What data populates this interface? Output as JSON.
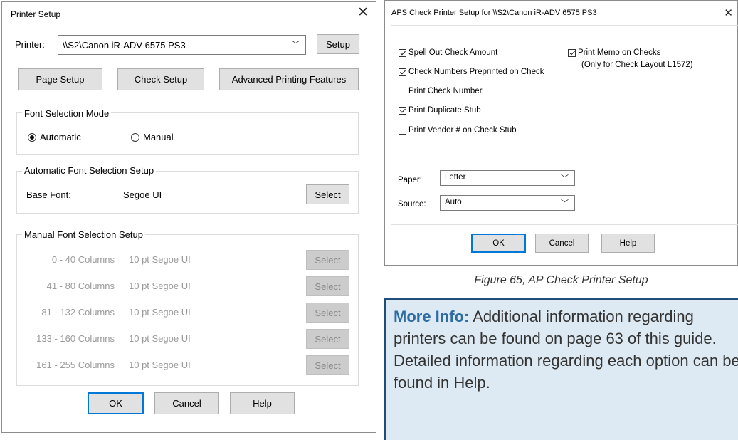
{
  "printer_setup": {
    "title": "Printer Setup",
    "printer_label": "Printer:",
    "printer_value": "\\\\S2\\Canon iR-ADV 6575 PS3",
    "setup_button": "Setup",
    "page_setup_button": "Page Setup",
    "check_setup_button": "Check Setup",
    "advanced_button": "Advanced Printing Features",
    "font_mode_group": "Font Selection Mode",
    "automatic_label": "Automatic",
    "manual_label": "Manual",
    "font_mode_selected": "Automatic",
    "auto_group": "Automatic Font Selection Setup",
    "base_font_label": "Base Font:",
    "base_font_value": "Segoe UI",
    "select_label": "Select",
    "manual_group": "Manual Font Selection Setup",
    "manual_rows": [
      {
        "columns": "0 - 40 Columns",
        "font": "10 pt Segoe UI",
        "button": "Select"
      },
      {
        "columns": "41 - 80 Columns",
        "font": "10 pt Segoe UI",
        "button": "Select"
      },
      {
        "columns": "81 - 132 Columns",
        "font": "10 pt Segoe UI",
        "button": "Select"
      },
      {
        "columns": "133 - 160 Columns",
        "font": "10 pt Segoe UI",
        "button": "Select"
      },
      {
        "columns": "161 - 255 Columns",
        "font": "10 pt Segoe UI",
        "button": "Select"
      }
    ],
    "ok": "OK",
    "cancel": "Cancel",
    "help": "Help"
  },
  "aps_setup": {
    "title": "APS Check Printer Setup for \\\\S2\\Canon iR-ADV 6575 PS3",
    "checkboxes": [
      {
        "label": "Spell Out Check Amount",
        "checked": true
      },
      {
        "label": "Check Numbers Preprinted on Check",
        "checked": true
      },
      {
        "label": "Print Check Number",
        "checked": false
      },
      {
        "label": "Print Duplicate Stub",
        "checked": true
      },
      {
        "label": "Print Vendor # on Check Stub",
        "checked": false
      }
    ],
    "memo_checkbox": {
      "label": "Print Memo on Checks",
      "checked": true
    },
    "memo_note": "(Only for Check Layout L1572)",
    "paper_label": "Paper:",
    "paper_value": "Letter",
    "source_label": "Source:",
    "source_value": "Auto",
    "ok": "OK",
    "cancel": "Cancel",
    "help": "Help"
  },
  "caption": "Figure 65, AP Check Printer Setup",
  "more_info": {
    "lead": "More Info:",
    "text": " Additional information regarding printers can be found on page 63 of this guide. Detailed information regarding each option can be found in Help."
  },
  "icons": {
    "close": "close-icon",
    "dropdown": "chevron-down-icon"
  },
  "colors": {
    "accent": "#0078d7",
    "info_bg": "#ddeaf3",
    "info_lead": "#2e6da4"
  }
}
